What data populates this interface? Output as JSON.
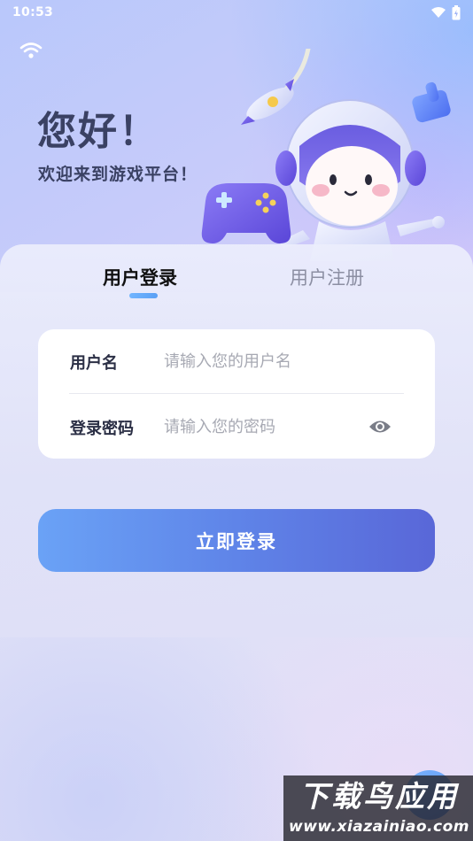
{
  "status_bar": {
    "time": "10:53"
  },
  "header": {
    "greeting": "您好！",
    "welcome": "欢迎来到游戏平台！"
  },
  "tabs": {
    "login": "用户登录",
    "register": "用户注册",
    "active": "login"
  },
  "form": {
    "username_label": "用户名",
    "username_placeholder": "请输入您的用户名",
    "username_value": "",
    "password_label": "登录密码",
    "password_placeholder": "请输入您的密码",
    "password_value": ""
  },
  "actions": {
    "login_button": "立即登录"
  },
  "watermark": {
    "title": "下载鸟应用",
    "url": "www.xiazainiao.com"
  },
  "colors": {
    "accent": "#5f84e8",
    "tab_indicator": "#6aaff8",
    "heading": "#3a4163"
  }
}
